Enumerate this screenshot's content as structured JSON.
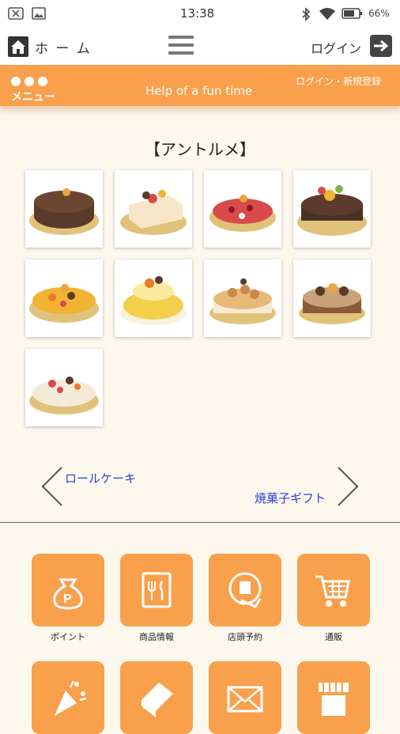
{
  "status_bar": {
    "time": "13:38",
    "battery": "66%",
    "icons": [
      "close-box-icon",
      "image-icon",
      "bluetooth-icon",
      "wifi-icon",
      "battery-icon"
    ]
  },
  "top_nav": {
    "home_label": "ホ ー ム",
    "login_label": "ログイン",
    "icons": [
      "home-icon",
      "hamburger-menu-icon",
      "login-arrow-icon"
    ]
  },
  "header": {
    "menu_label": "メニュー",
    "tagline": "Help of a fun time",
    "register_link": "ログイン・新規登録"
  },
  "section": {
    "title": "【アントルメ】",
    "products": [
      {
        "name": "chocolate-cake",
        "color": "#5a3a2a"
      },
      {
        "name": "strawberry-shortcake",
        "color": "#f7e6c8"
      },
      {
        "name": "berry-tart",
        "color": "#d94a4a"
      },
      {
        "name": "chocolate-fruit-cake",
        "color": "#4a3024"
      },
      {
        "name": "mango-tart",
        "color": "#f2b233"
      },
      {
        "name": "fruit-pudding-cake",
        "color": "#f4cf4b"
      },
      {
        "name": "cream-puff-cake",
        "color": "#e8b978"
      },
      {
        "name": "chocolate-cream-cake",
        "color": "#8a5a3a"
      },
      {
        "name": "fruit-cream-tart",
        "color": "#f3ead9"
      }
    ]
  },
  "pager": {
    "prev_label": "ロールケーキ",
    "next_label": "焼菓子ギフト"
  },
  "tiles": [
    {
      "label": "ポイント",
      "icon": "point-bag-icon"
    },
    {
      "label": "商品情報",
      "icon": "menu-book-icon"
    },
    {
      "label": "店頭予約",
      "icon": "reservation-icon"
    },
    {
      "label": "通販",
      "icon": "cart-icon"
    },
    {
      "label": "",
      "icon": "party-popper-icon"
    },
    {
      "label": "",
      "icon": "book-icon"
    },
    {
      "label": "",
      "icon": "mail-icon"
    },
    {
      "label": "",
      "icon": "shop-icon"
    }
  ],
  "colors": {
    "accent": "#f9a04c",
    "background": "#fcf8ee",
    "link": "#2a3fd6"
  }
}
